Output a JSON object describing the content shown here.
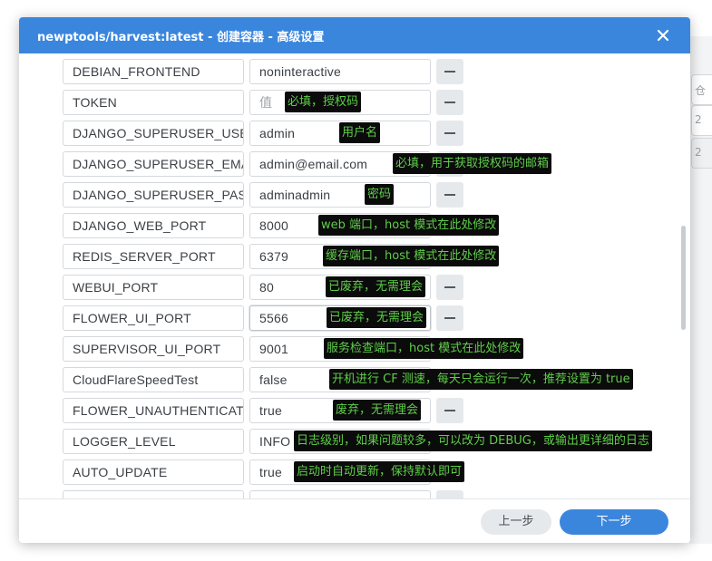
{
  "dialog": {
    "title": "newptools/harvest:latest - 创建容器 - 高级设置",
    "close_icon": "close-icon"
  },
  "background": {
    "snippet_1": "仓",
    "snippet_2": "2",
    "snippet_3": "2"
  },
  "env_vars": [
    {
      "name": "DEBIAN_FRONTEND",
      "value": "noninteractive",
      "placeholder": "",
      "removable": true,
      "note": ""
    },
    {
      "name": "TOKEN",
      "value": "",
      "placeholder": "值",
      "removable": true,
      "note": "必填，授权码"
    },
    {
      "name": "DJANGO_SUPERUSER_USE",
      "value": "admin",
      "placeholder": "",
      "removable": true,
      "note": "用户名"
    },
    {
      "name": "DJANGO_SUPERUSER_EMA",
      "value": "admin@email.com",
      "placeholder": "",
      "removable": true,
      "note": "必填，用于获取授权码的邮箱"
    },
    {
      "name": "DJANGO_SUPERUSER_PAS",
      "value": "adminadmin",
      "placeholder": "",
      "removable": true,
      "note": "密码"
    },
    {
      "name": "DJANGO_WEB_PORT",
      "value": "8000",
      "placeholder": "",
      "removable": false,
      "note": "web 端口，host 模式在此处修改"
    },
    {
      "name": "REDIS_SERVER_PORT",
      "value": "6379",
      "placeholder": "",
      "removable": false,
      "note": "缓存端口，host 模式在此处修改"
    },
    {
      "name": "WEBUI_PORT",
      "value": "80",
      "placeholder": "",
      "removable": true,
      "note": "已废弃，无需理会"
    },
    {
      "name": "FLOWER_UI_PORT",
      "value": "5566",
      "placeholder": "",
      "removable": true,
      "note": "已废弃，无需理会"
    },
    {
      "name": "SUPERVISOR_UI_PORT",
      "value": "9001",
      "placeholder": "",
      "removable": false,
      "note": "服务检查端口，host 模式在此处修改"
    },
    {
      "name": "CloudFlareSpeedTest",
      "value": "false",
      "placeholder": "",
      "removable": false,
      "note": "开机进行 CF 测速，每天只会运行一次，推荐设置为 true"
    },
    {
      "name": "FLOWER_UNAUTHENTICAT",
      "value": "true",
      "placeholder": "",
      "removable": true,
      "note": "废弃，无需理会"
    },
    {
      "name": "LOGGER_LEVEL",
      "value": "INFO",
      "placeholder": "",
      "removable": false,
      "note": "日志级别，如果问题较多，可以改为 DEBUG，或输出更详细的日志"
    },
    {
      "name": "AUTO_UPDATE",
      "value": "true",
      "placeholder": "",
      "removable": false,
      "note": "启动时自动更新，保持默认即可"
    }
  ],
  "footer": {
    "prev_label": "上一步",
    "next_label": "下一步"
  },
  "colors": {
    "title_bar": "#3b86dd",
    "primary_button": "#3b86dd",
    "note_bg": "#0b0b0b",
    "note_text": "#5fce4a"
  }
}
